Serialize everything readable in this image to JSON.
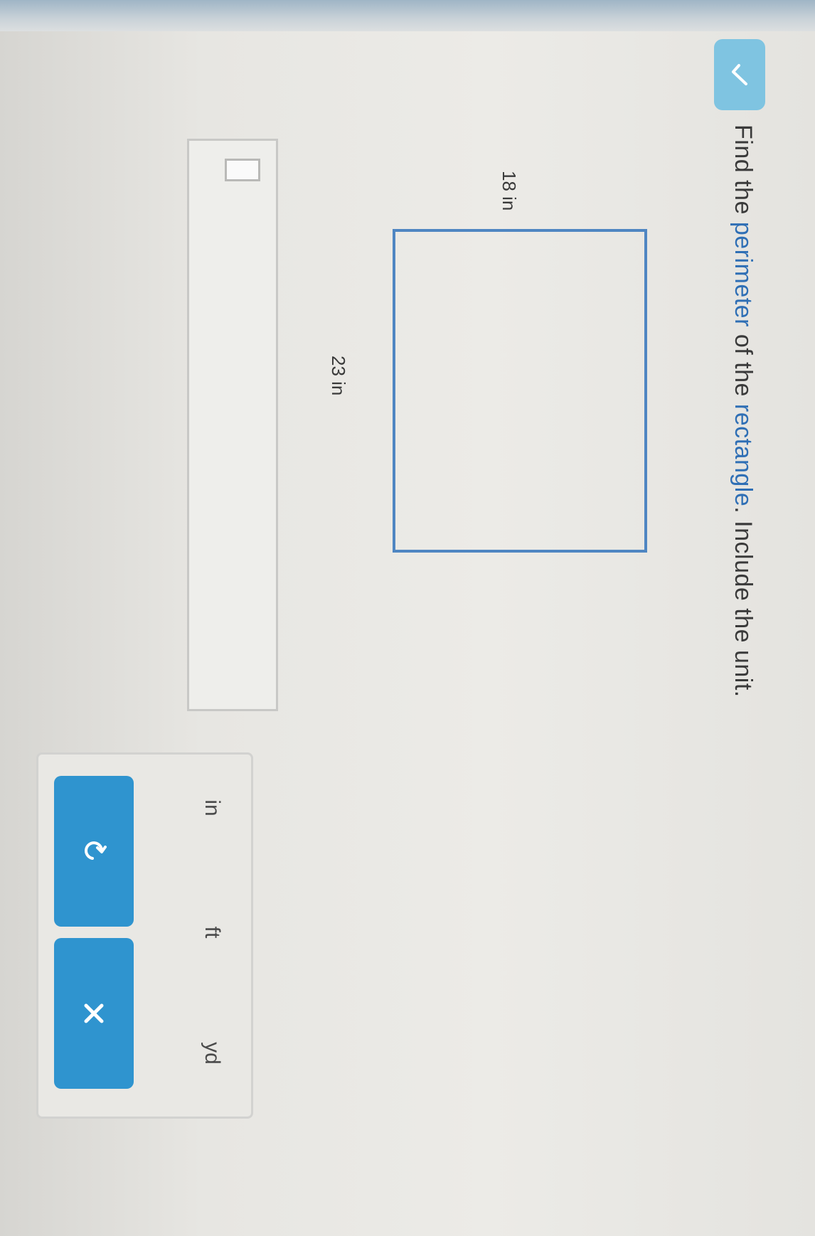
{
  "check_tab": {
    "icon": "check-icon"
  },
  "question": {
    "prefix": "Find the ",
    "term": "perimeter",
    "middle": " of the ",
    "term2": "rectangle",
    "suffix": ". Include the unit."
  },
  "figure": {
    "shape": "rectangle",
    "side_label": "18 in",
    "bottom_label": "23 in"
  },
  "answer": {
    "value": ""
  },
  "unit_panel": {
    "units": [
      "in",
      "ft",
      "yd"
    ],
    "undo_icon": "undo-icon",
    "clear_icon": "close-icon"
  },
  "colors": {
    "accent": "#2f94cf",
    "shape_stroke": "#4f86c2",
    "check_tab": "#7fc4e1",
    "link": "#2f6fb5"
  }
}
